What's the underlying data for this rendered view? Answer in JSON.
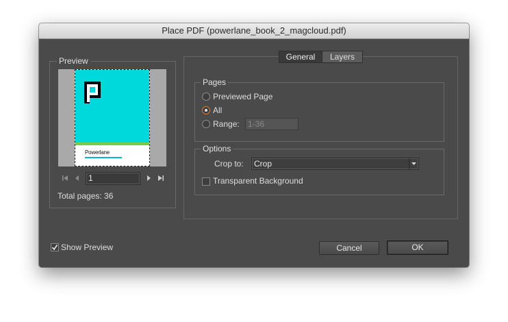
{
  "window": {
    "title": "Place PDF (powerlane_book_2_magcloud.pdf)"
  },
  "preview": {
    "legend": "Preview",
    "thumb_brand": "Powerlane",
    "page_field_value": "1",
    "total_pages_label": "Total pages: 36",
    "show_preview_label": "Show Preview",
    "colors": {
      "cyan": "#00d9db",
      "green": "#7ac943"
    }
  },
  "tabs": [
    {
      "label": "General",
      "selected": true
    },
    {
      "label": "Layers",
      "selected": false
    }
  ],
  "pages": {
    "legend": "Pages",
    "options": [
      "Previewed Page",
      "All",
      "Range:"
    ],
    "selected": "All",
    "range_placeholder": "1-36"
  },
  "options": {
    "legend": "Options",
    "crop_label": "Crop to:",
    "crop_value": "Crop",
    "transparent_label": "Transparent Background"
  },
  "buttons": {
    "cancel": "Cancel",
    "ok": "OK"
  },
  "icons": [
    "first-page-icon",
    "prev-page-icon",
    "next-page-icon",
    "last-page-icon",
    "chevron-down-icon",
    "checkmark-icon"
  ],
  "accent": "#d77a3a"
}
